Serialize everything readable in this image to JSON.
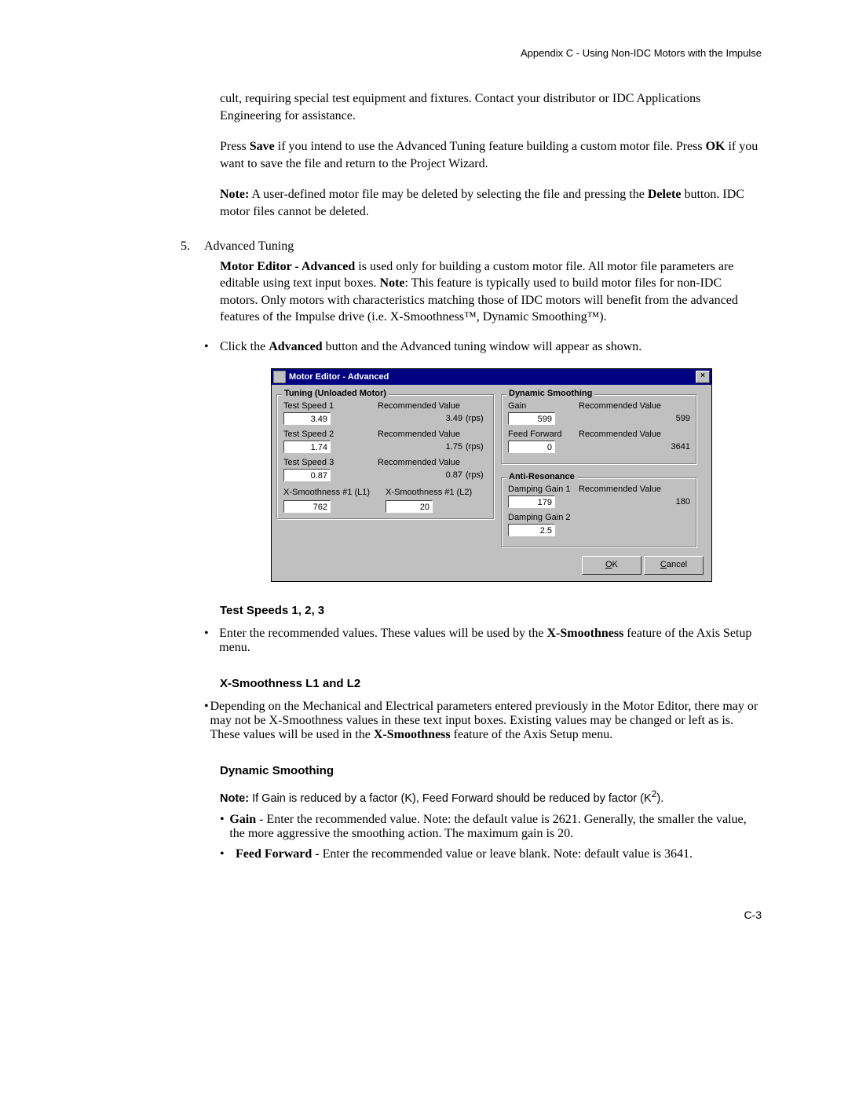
{
  "header": "Appendix C - Using Non-IDC Motors with the Impulse",
  "intro": {
    "p1": "cult, requiring special test equipment and fixtures. Contact your distributor or IDC Applications Engineering for assistance.",
    "p2a": "Press ",
    "p2b": "Save",
    "p2c": " if you intend to use the Advanced Tuning feature building a custom motor file. Press ",
    "p2d": "OK",
    "p2e": " if you want to save the file and return to the Project Wizard.",
    "p3a": "Note:",
    "p3b": " A user-defined motor file may be deleted by selecting the file and pressing the ",
    "p3c": "Delete",
    "p3d": " button. IDC motor files cannot be deleted."
  },
  "step": {
    "num": "5.",
    "title": "Advanced Tuning"
  },
  "adv": {
    "p1a": "Motor Editor - Advanced",
    "p1b": " is used only for building a custom motor file. All motor file parameters are editable using text input boxes. ",
    "p1c": "Note",
    "p1d": ": This feature is typically used to build motor files for non-IDC motors. Only motors with characteristics matching those of IDC motors will benefit from the advanced features of the Impulse drive (i.e. X-Smoothness™, Dynamic Smoothing™).",
    "b1a": "Click the ",
    "b1b": "Advanced",
    "b1c": " button and the Advanced tuning window will appear as shown."
  },
  "dialog": {
    "title": "Motor Editor - Advanced",
    "tuning_legend": "Tuning (Unloaded Motor)",
    "dynamic_legend": "Dynamic Smoothing",
    "anti_legend": "Anti-Resonance",
    "rec_label": "Recommended Value",
    "ts1_label": "Test Speed 1",
    "ts1_val": "3.49",
    "ts1_rec": "3.49",
    "ts2_label": "Test Speed 2",
    "ts2_val": "1.74",
    "ts2_rec": "1.75",
    "ts3_label": "Test Speed 3",
    "ts3_val": "0.87",
    "ts3_rec": "0.87",
    "units": "(rps)",
    "xs1_label": "X-Smoothness #1 (L1)",
    "xs1_val": "762",
    "xs2_label": "X-Smoothness #1 (L2)",
    "xs2_val": "20",
    "gain_label": "Gain",
    "gain_val": "599",
    "gain_rec": "599",
    "ff_label": "Feed Forward",
    "ff_val": "0",
    "ff_rec": "3641",
    "dg1_label": "Damping Gain 1",
    "dg1_val": "179",
    "dg1_rec": "180",
    "dg2_label": "Damping Gain 2",
    "dg2_val": "2.5",
    "ok_u": "O",
    "ok_r": "K",
    "cancel_u": "C",
    "cancel_r": "ancel"
  },
  "sections": {
    "ts_head": "Test Speeds 1, 2, 3",
    "ts_b1a": "Enter the recommended values. These values will be used by the ",
    "ts_b1b": "X-Smoothness",
    "ts_b1c": " feature of the Axis Setup menu.",
    "xs_head": "X-Smoothness L1 and L2",
    "xs_b1a": "Depending on the Mechanical and Electrical parameters entered previously in the Motor Editor, there may or may not be X-Smoothness values in these text input boxes. Existing values may be changed or left as is. These values will be used in the ",
    "xs_b1b": "X-Smoothness",
    "xs_b1c": " feature of the Axis Setup menu.",
    "ds_head": "Dynamic Smoothing",
    "ds_note_a": "Note:",
    "ds_note_b": " If Gain is reduced by a factor (K), Feed Forward should be reduced by factor (K",
    "ds_note_c": "2",
    "ds_note_d": ").",
    "ds_b1a": "Gain",
    "ds_b1b": " - Enter the recommended value. Note: the default value is 2621. Generally, the smaller the value, the more aggressive the smoothing action. The maximum gain is 20.",
    "ds_b2a": "Feed Forward - ",
    "ds_b2b": "Enter the recommended value or leave blank. Note: default value is 3641."
  },
  "footer": "C-3"
}
